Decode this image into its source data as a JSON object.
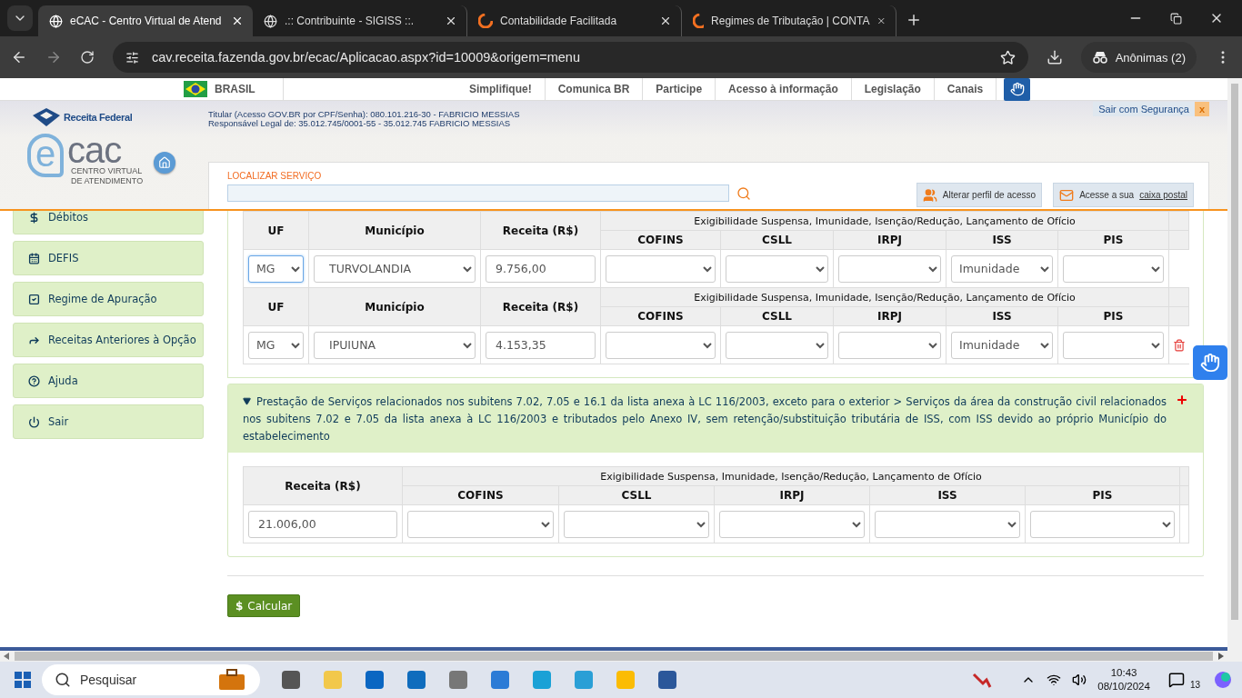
{
  "browser": {
    "tabs": [
      {
        "title": "eCAC - Centro Virtual de Atend",
        "selected": true,
        "kind": "site"
      },
      {
        "title": ".:: Contribuinte - SIGISS ::.",
        "selected": false,
        "kind": "site"
      },
      {
        "title": "Contabilidade Facilitada",
        "selected": false,
        "kind": "brand"
      },
      {
        "title": "Regimes de Tributação | CONTA",
        "selected": false,
        "kind": "brand"
      }
    ],
    "address": "cav.receita.fazenda.gov.br/ecac/Aplicacao.aspx?id=10009&origem=menu",
    "profile": "Anônimas (2)"
  },
  "gov_bar": {
    "country": "BRASIL",
    "links": [
      "Simplifique!",
      "Comunica BR",
      "Participe",
      "Acesso à informação",
      "Legislação",
      "Canais"
    ]
  },
  "header": {
    "agency": "Receita Federal",
    "logo_letter": "e",
    "logo_word": "cac",
    "logo_lines": [
      "CENTRO VIRTUAL",
      "DE ATENDIMENTO"
    ],
    "user_lines": [
      "Titular (Acesso GOV.BR por CPF/Senha): 080.101.216-30 - FABRICIO MESSIAS",
      "Responsável Legal de: 35.012.745/0001-55 - 35.012.745 FABRICIO MESSIAS"
    ],
    "logout": "Sair com Segurança",
    "logout_close": "x",
    "search_label": "LOCALIZAR SERVIÇO",
    "profile_button": "Alterar perfil de acesso",
    "mailbox_prefix": "Acesse a sua",
    "mailbox_link": "caixa postal"
  },
  "sidebar": {
    "items": [
      {
        "label": "Débitos"
      },
      {
        "label": "DEFIS"
      },
      {
        "label": "Regime de Apuração"
      },
      {
        "label": "Receitas Anteriores à Opção"
      },
      {
        "label": "Ajuda"
      },
      {
        "label": "Sair"
      }
    ]
  },
  "section_1": {
    "rows": [
      {
        "columns": [
          "UF",
          "Município",
          "Receita (R$)"
        ],
        "group_header": "Exigibilidade Suspensa, Imunidade, Isenção/Redução, Lançamento de Ofício",
        "tax_columns": [
          "COFINS",
          "CSLL",
          "IRPJ",
          "ISS",
          "PIS"
        ],
        "uf": "MG",
        "uf_focused": true,
        "municipio": "TURVOLANDIA",
        "receita": "9.756,00",
        "iss_value": "Imunidade",
        "deletable": false
      },
      {
        "columns": [
          "UF",
          "Município",
          "Receita (R$)"
        ],
        "group_header": "Exigibilidade Suspensa, Imunidade, Isenção/Redução, Lançamento de Ofício",
        "tax_columns": [
          "COFINS",
          "CSLL",
          "IRPJ",
          "ISS",
          "PIS"
        ],
        "uf": "MG",
        "uf_focused": false,
        "municipio": "IPUIUNA",
        "receita": "4.153,35",
        "iss_value": "Imunidade",
        "deletable": true
      }
    ]
  },
  "section_2": {
    "expanded": true,
    "title": "Prestação de Serviços relacionados nos subitens 7.02, 7.05 e 16.1 da lista anexa à LC 116/2003, exceto para o exterior > Serviços da área da construção civil relacionados nos subitens 7.02 e 7.05 da lista anexa à LC 116/2003 e tributados pelo Anexo IV, sem retenção/substituição tributária de ISS, com ISS devido ao próprio Município do estabelecimento",
    "table": {
      "column": "Receita (R$)",
      "group_header": "Exigibilidade Suspensa, Imunidade, Isenção/Redução, Lançamento de Ofício",
      "tax_columns": [
        "COFINS",
        "CSLL",
        "IRPJ",
        "ISS",
        "PIS"
      ],
      "receita": "21.006,00"
    }
  },
  "calculate": {
    "icon_text": "$",
    "label": "Calcular"
  },
  "taskbar": {
    "search_placeholder": "Pesquisar",
    "time": "10:43",
    "date": "08/10/2024",
    "notifications": "13"
  }
}
